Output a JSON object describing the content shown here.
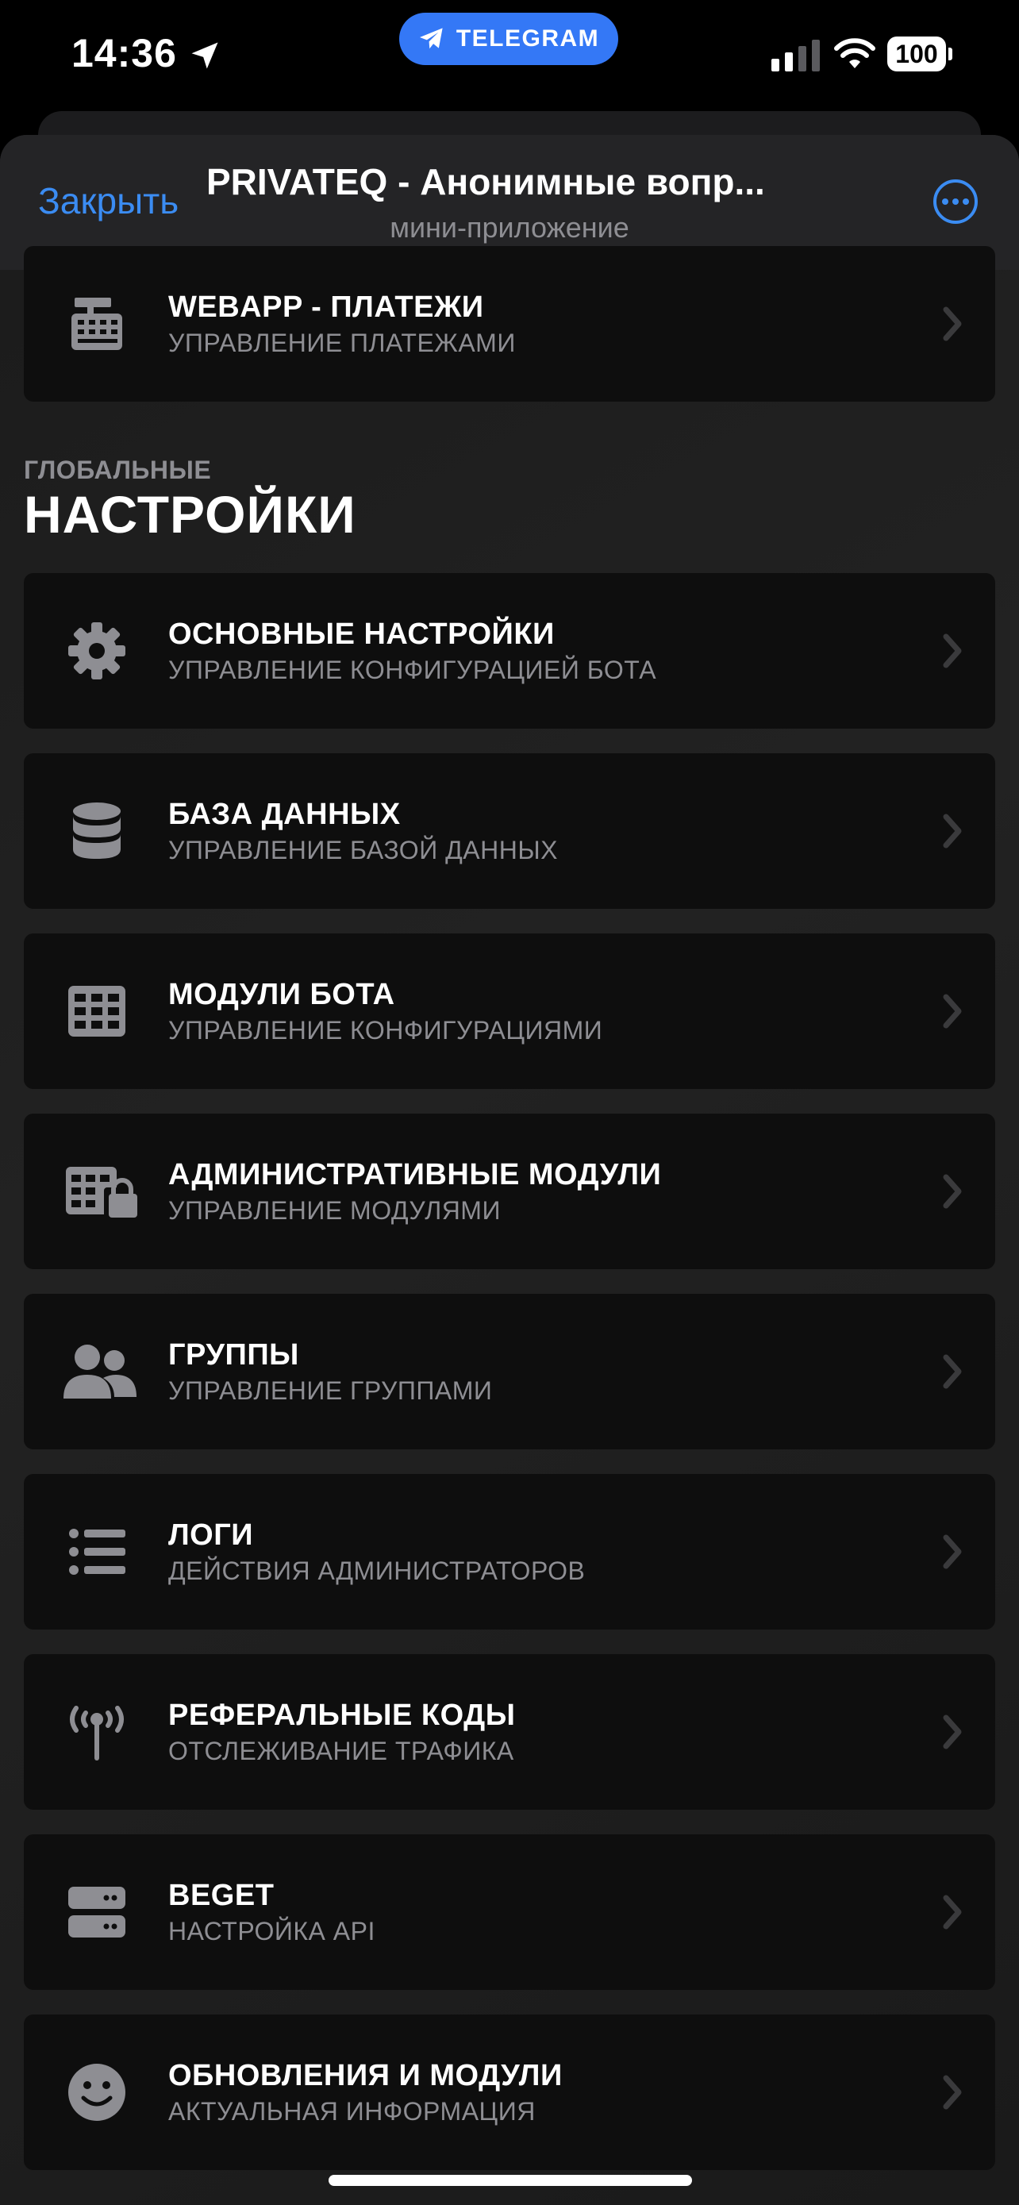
{
  "status_bar": {
    "time": "14:36",
    "pill_label": "TELEGRAM",
    "battery": "100",
    "accent": "#3478f6"
  },
  "header": {
    "close_label": "Закрыть",
    "title": "PRIVATEQ - Анонимные вопр...",
    "subtitle": "мини-приложение",
    "more_icon": "ellipsis-circle-icon",
    "link_color": "#3b8cf2"
  },
  "payments_card": {
    "icon": "cash-register-icon",
    "title": "WEBAPP - ПЛАТЕЖИ",
    "desc": "УПРАВЛЕНИЕ ПЛАТЕЖАМИ"
  },
  "section": {
    "overline": "ГЛОБАЛЬНЫЕ",
    "title": "НАСТРОЙКИ"
  },
  "items": [
    {
      "icon": "gear-icon",
      "title": "ОСНОВНЫЕ НАСТРОЙКИ",
      "desc": "УПРАВЛЕНИЕ КОНФИГУРАЦИЕЙ БОТА"
    },
    {
      "icon": "database-icon",
      "title": "БАЗА ДАННЫХ",
      "desc": "УПРАВЛЕНИЕ БАЗОЙ ДАННЫХ"
    },
    {
      "icon": "grid-table-icon",
      "title": "МОДУЛИ БОТА",
      "desc": "УПРАВЛЕНИЕ КОНФИГУРАЦИЯМИ"
    },
    {
      "icon": "table-lock-icon",
      "title": "АДМИНИСТРАТИВНЫЕ МОДУЛИ",
      "desc": "УПРАВЛЕНИЕ МОДУЛЯМИ"
    },
    {
      "icon": "users-icon",
      "title": "ГРУППЫ",
      "desc": "УПРАВЛЕНИЕ ГРУППАМИ"
    },
    {
      "icon": "list-icon",
      "title": "ЛОГИ",
      "desc": "ДЕЙСТВИЯ АДМИНИСТРАТОРОВ"
    },
    {
      "icon": "broadcast-tower-icon",
      "title": "РЕФЕРАЛЬНЫЕ КОДЫ",
      "desc": "ОТСЛЕЖИВАНИЕ ТРАФИКА"
    },
    {
      "icon": "server-icon",
      "title": "BEGET",
      "desc": "НАСТРОЙКА API"
    },
    {
      "icon": "smile-icon",
      "title": "ОБНОВЛЕНИЯ И МОДУЛИ",
      "desc": "АКТУАЛЬНАЯ ИНФОРМАЦИЯ"
    }
  ]
}
